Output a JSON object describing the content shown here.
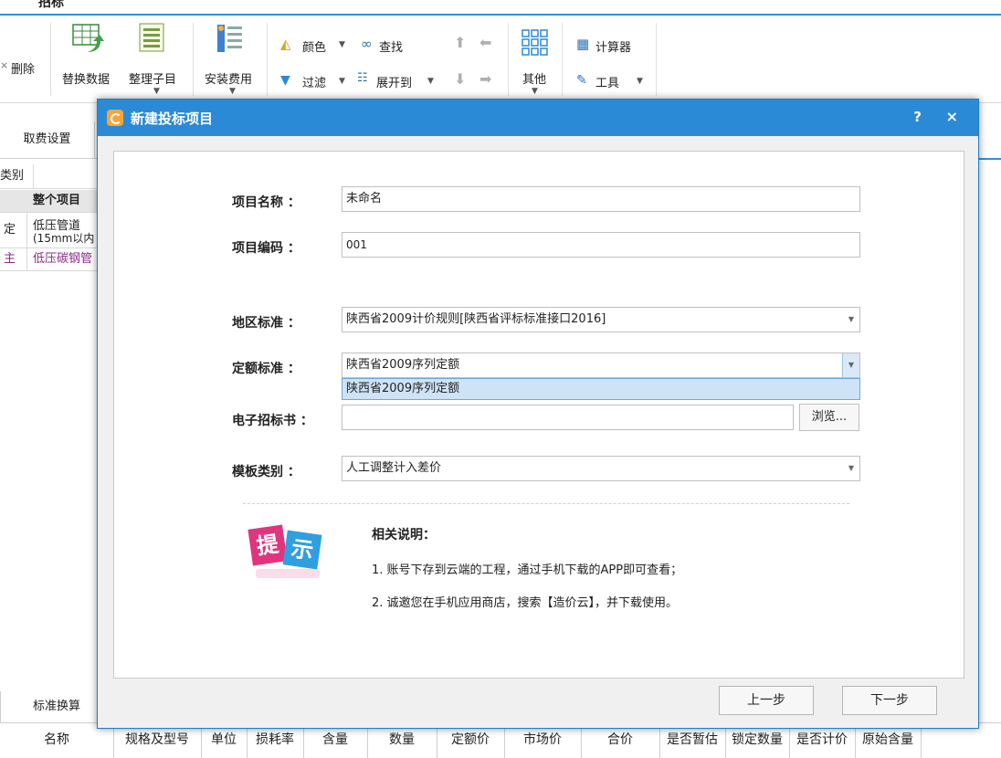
{
  "app": {
    "title": "招标",
    "ribbon": {
      "delete_label": "删除",
      "replace_data": "替换数据",
      "organize_sub": "整理子目",
      "install_fee": "安装费用",
      "color": "颜色",
      "filter": "过滤",
      "find": "查找",
      "expand_to": "展开到",
      "other": "其他",
      "calculator": "计算器",
      "tools": "工具"
    },
    "tab_fee_settings": "取费设置",
    "left_table": {
      "header": "类别",
      "rows": [
        {
          "c1": "",
          "c2": "整个项目"
        },
        {
          "c1": "定",
          "c2": "低压管道",
          "c2b": "(15mm以内"
        },
        {
          "c1": "主",
          "c2": "低压碳钢管"
        }
      ]
    },
    "bottom_tab": "标准换算",
    "bottom_columns": [
      "名称",
      "规格及型号",
      "单位",
      "损耗率",
      "含量",
      "数量",
      "定额价",
      "市场价",
      "合价",
      "是否暂估",
      "锁定数量",
      "是否计价",
      "原始含量"
    ]
  },
  "dialog": {
    "title": "新建投标项目",
    "help": "?",
    "close": "×",
    "fields": {
      "project_name_label": "项目名称 ：",
      "project_name_value": "未命名",
      "project_code_label": "项目编码 ：",
      "project_code_value": "001",
      "region_label": "地区标准 ：",
      "region_value": "陕西省2009计价规则[陕西省评标标准接口2016]",
      "quota_label": "定额标准 ：",
      "quota_value": "陕西省2009序列定额",
      "quota_option": "陕西省2009序列定额",
      "etender_label": "电子招标书 ：",
      "etender_value": "",
      "browse_label": "浏览...",
      "template_label": "模板类别 ：",
      "template_value": "人工调整计入差价"
    },
    "notes": {
      "title": "相关说明：",
      "line1": "1. 账号下存到云端的工程，通过手机下载的APP即可查看；",
      "line2": "2. 诚邀您在手机应用商店，搜索【造价云】，并下载使用。"
    },
    "tip_icon_text": [
      "提",
      "示"
    ],
    "buttons": {
      "prev": "上一步",
      "next": "下一步"
    }
  },
  "colors": {
    "accent": "#2b8ad6",
    "tip_pink": "#e0357e",
    "tip_blue": "#2f9fe0"
  }
}
